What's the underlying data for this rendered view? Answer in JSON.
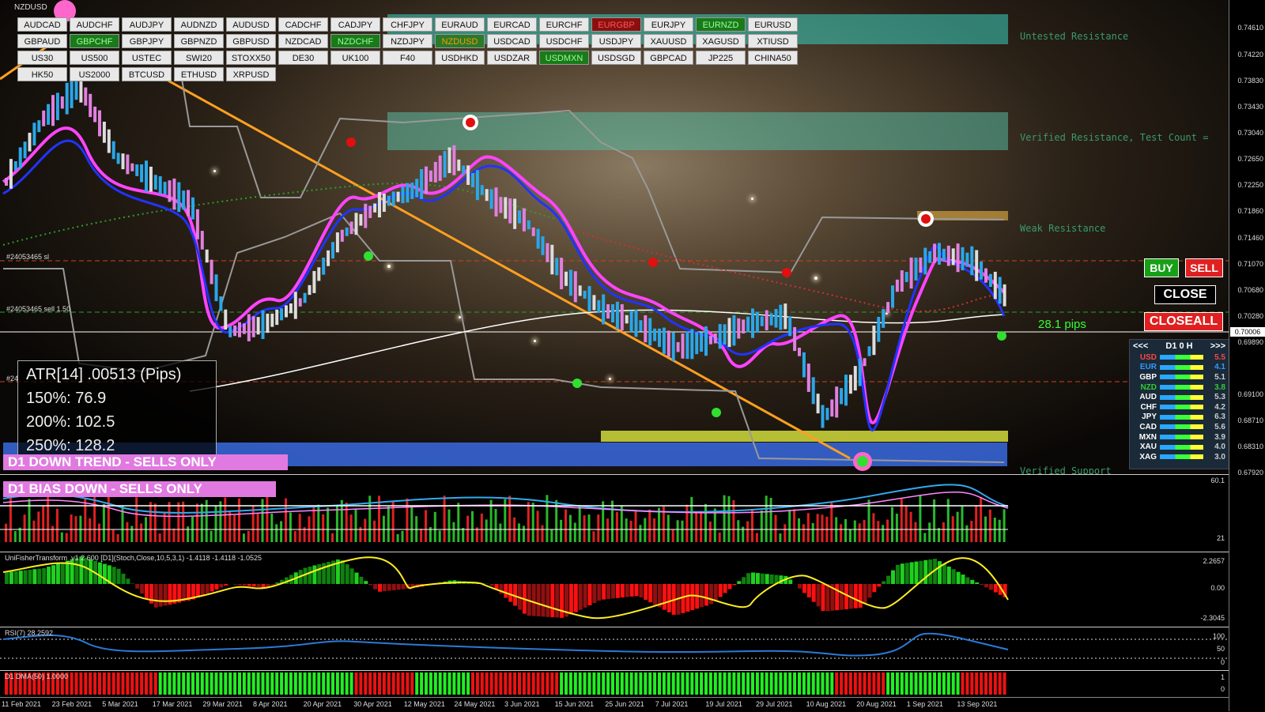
{
  "symbol": "NZDUSD",
  "symbol_buttons": [
    {
      "label": "AUDCAD",
      "state": "normal"
    },
    {
      "label": "AUDCHF",
      "state": "normal"
    },
    {
      "label": "AUDJPY",
      "state": "normal"
    },
    {
      "label": "AUDNZD",
      "state": "normal"
    },
    {
      "label": "AUDUSD",
      "state": "normal"
    },
    {
      "label": "CADCHF",
      "state": "normal"
    },
    {
      "label": "CADJPY",
      "state": "normal"
    },
    {
      "label": "CHFJPY",
      "state": "normal"
    },
    {
      "label": "EURAUD",
      "state": "normal"
    },
    {
      "label": "EURCAD",
      "state": "normal"
    },
    {
      "label": "EURCHF",
      "state": "normal"
    },
    {
      "label": "EURGBP",
      "state": "red"
    },
    {
      "label": "EURJPY",
      "state": "normal"
    },
    {
      "label": "EURNZD",
      "state": "green"
    },
    {
      "label": "EURUSD",
      "state": "normal"
    },
    {
      "label": "GBPAUD",
      "state": "normal"
    },
    {
      "label": "GBPCHF",
      "state": "green"
    },
    {
      "label": "GBPJPY",
      "state": "normal"
    },
    {
      "label": "GBPNZD",
      "state": "normal"
    },
    {
      "label": "GBPUSD",
      "state": "normal"
    },
    {
      "label": "NZDCAD",
      "state": "normal"
    },
    {
      "label": "NZDCHF",
      "state": "green"
    },
    {
      "label": "NZDJPY",
      "state": "normal"
    },
    {
      "label": "NZDUSD",
      "state": "orange"
    },
    {
      "label": "USDCAD",
      "state": "normal"
    },
    {
      "label": "USDCHF",
      "state": "normal"
    },
    {
      "label": "USDJPY",
      "state": "normal"
    },
    {
      "label": "XAUUSD",
      "state": "normal"
    },
    {
      "label": "XAGUSD",
      "state": "normal"
    },
    {
      "label": "XTIUSD",
      "state": "normal"
    },
    {
      "label": "US30",
      "state": "normal"
    },
    {
      "label": "US500",
      "state": "normal"
    },
    {
      "label": "USTEC",
      "state": "normal"
    },
    {
      "label": "SWI20",
      "state": "normal"
    },
    {
      "label": "STOXX50",
      "state": "normal"
    },
    {
      "label": "DE30",
      "state": "normal"
    },
    {
      "label": "UK100",
      "state": "normal"
    },
    {
      "label": "F40",
      "state": "normal"
    },
    {
      "label": "USDHKD",
      "state": "normal"
    },
    {
      "label": "USDZAR",
      "state": "normal"
    },
    {
      "label": "USDMXN",
      "state": "green"
    },
    {
      "label": "USDSGD",
      "state": "normal"
    },
    {
      "label": "GBPCAD",
      "state": "normal"
    },
    {
      "label": "JP225",
      "state": "normal"
    },
    {
      "label": "CHINA50",
      "state": "normal"
    },
    {
      "label": "HK50",
      "state": "normal"
    },
    {
      "label": "US2000",
      "state": "normal"
    },
    {
      "label": "BTCUSD",
      "state": "normal"
    },
    {
      "label": "ETHUSD",
      "state": "normal"
    },
    {
      "label": "XRPUSD",
      "state": "normal"
    }
  ],
  "zones": {
    "untested_resistance": "Untested Resistance",
    "verified_resistance": "Verified Resistance, Test Count =",
    "weak_resistance": "Weak Resistance",
    "verified_support": "Verified Support"
  },
  "order_labels": {
    "sl": "#24053465 sl",
    "sell": "#24053465 sell 1.50",
    "tp": "#24"
  },
  "atr": {
    "line1": "ATR[14] .00513  (Pips)",
    "line2": "150%: 76.9",
    "line3": "200%: 102.5",
    "line4": "250%: 128.2"
  },
  "banners": {
    "trend": "D1  DOWN TREND - SELLS ONLY",
    "bias": "D1  BIAS DOWN - SELLS ONLY"
  },
  "trade_buttons": {
    "buy": "BUY",
    "sell": "SELL",
    "close": "CLOSE",
    "closeall": "CLOSEALL"
  },
  "pips_text": "28.1 pips",
  "strength_panel": {
    "prev": "<<<",
    "title": "D1  0  H",
    "next": ">>>",
    "rows": [
      {
        "currency": "USD",
        "value": "5.5",
        "color": "#ff4444"
      },
      {
        "currency": "EUR",
        "value": "4.1",
        "color": "#3399ff"
      },
      {
        "currency": "GBP",
        "value": "5.1",
        "color": "#ffffff"
      },
      {
        "currency": "NZD",
        "value": "3.8",
        "color": "#33cc33"
      },
      {
        "currency": "AUD",
        "value": "5.3",
        "color": "#ffffff"
      },
      {
        "currency": "CHF",
        "value": "4.2",
        "color": "#ffffff"
      },
      {
        "currency": "JPY",
        "value": "6.3",
        "color": "#ffffff"
      },
      {
        "currency": "CAD",
        "value": "5.6",
        "color": "#ffffff"
      },
      {
        "currency": "MXN",
        "value": "3.9",
        "color": "#ffffff"
      },
      {
        "currency": "XAU",
        "value": "4.0",
        "color": "#ffffff"
      },
      {
        "currency": "XAG",
        "value": "3.0",
        "color": "#ffffff"
      }
    ]
  },
  "price_axis": [
    "0.74610",
    "0.74220",
    "0.73830",
    "0.73430",
    "0.73040",
    "0.72650",
    "0.72250",
    "0.71860",
    "0.71460",
    "0.71070",
    "0.70680",
    "0.70280",
    "0.69890",
    "0.69100",
    "0.68710",
    "0.68310",
    "0.67920"
  ],
  "current_price": "0.70006",
  "panels": {
    "volume_axis": [
      "60.1",
      "21"
    ],
    "fisher_title": "UniFisherTransform_v1.2 600 [D1](Stoch,Close,10,5,3,1) -1.4118 -1.4118 -1.0525",
    "fisher_axis": [
      "2.2657",
      "0.00",
      "-2.3045"
    ],
    "rsi_title": "RSI(7) 28.2592",
    "rsi_axis": [
      "100",
      "50",
      "0"
    ],
    "dma_title": "D1 DMA(50) 1.0000",
    "dma_axis": [
      "1",
      "0"
    ]
  },
  "dates": [
    "11 Feb 2021",
    "23 Feb 2021",
    "5 Mar 2021",
    "17 Mar 2021",
    "29 Mar 2021",
    "8 Apr 2021",
    "20 Apr 2021",
    "30 Apr 2021",
    "12 May 2021",
    "24 May 2021",
    "3 Jun 2021",
    "15 Jun 2021",
    "25 Jun 2021",
    "7 Jul 2021",
    "19 Jul 2021",
    "29 Jul 2021",
    "10 Aug 2021",
    "20 Aug 2021",
    "1 Sep 2021",
    "13 Sep 2021"
  ]
}
